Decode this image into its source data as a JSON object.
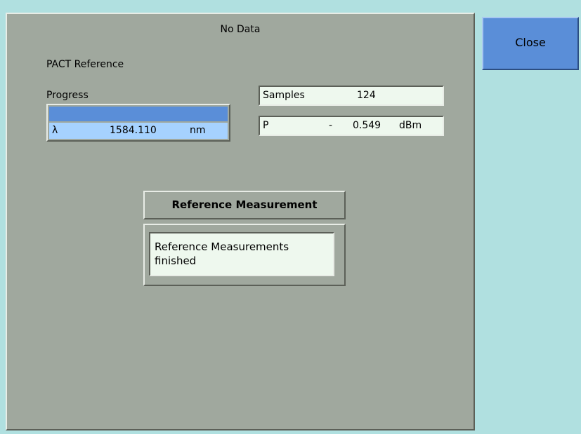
{
  "panel": {
    "title": "No Data",
    "section_label": "PACT Reference",
    "progress_label": "Progress",
    "progress_fraction": 1.0
  },
  "wavelength": {
    "symbol": "λ",
    "value": "1584.110",
    "unit": "nm"
  },
  "samples": {
    "label": "Samples",
    "value": "124"
  },
  "power": {
    "label": "P",
    "sign": "-",
    "value": "0.549",
    "unit": "dBm"
  },
  "reference": {
    "header": "Reference Measurement",
    "message_line1": "Reference Measurements",
    "message_line2": "finished"
  },
  "actions": {
    "close_label": "Close"
  },
  "colors": {
    "background": "#b0e0e0",
    "panel": "#a0a89e",
    "accent_blue": "#5a8ed8",
    "light_blue": "#a6d2ff",
    "field": "#eef8ee"
  }
}
